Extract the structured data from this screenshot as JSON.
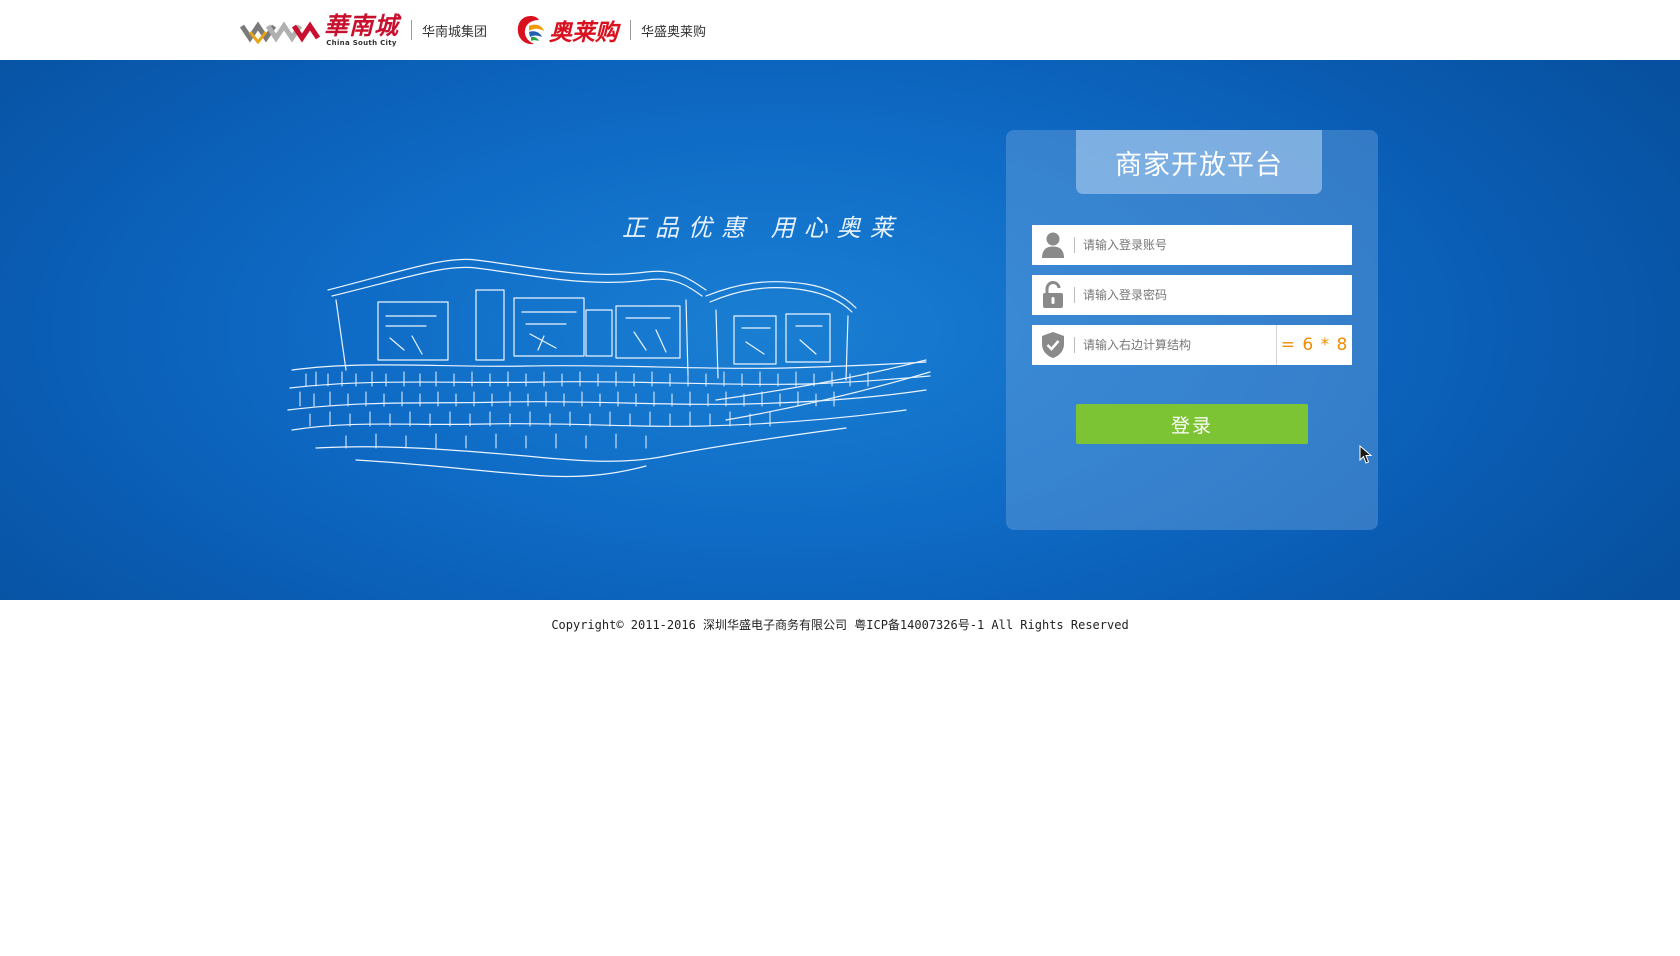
{
  "header": {
    "brand1": {
      "logo_text": "華南城",
      "logo_en": "China South City",
      "name": "华南城集团"
    },
    "brand2": {
      "logo_text": "奥莱购",
      "name": "华盛奥莱购"
    }
  },
  "banner": {
    "slogan": "正品优惠  用心奥莱",
    "illustration": "outlet-mall-sketch"
  },
  "login": {
    "title": "商家开放平台",
    "account": {
      "placeholder": "请输入登录账号",
      "value": "",
      "icon": "user-icon"
    },
    "password": {
      "placeholder": "请输入登录密码",
      "value": "",
      "icon": "lock-icon"
    },
    "captcha": {
      "placeholder": "请输入右边计算结构",
      "value": "",
      "icon": "shield-check-icon",
      "question": "= 6 * 8"
    },
    "submit_label": "登录"
  },
  "footer": {
    "copyright": "Copyright© 2011-2016 深圳华盛电子商务有限公司 粤ICP备14007326号-1 All Rights Reserved"
  },
  "colors": {
    "banner_blue": "#0f6cc6",
    "login_green": "#7dc435",
    "captcha_orange": "#f08c00",
    "brand_red": "#c8102e"
  }
}
